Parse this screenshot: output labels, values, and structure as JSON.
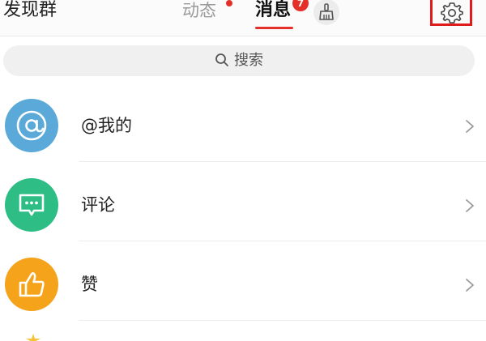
{
  "header": {
    "discover_label": "发现群",
    "tabs": [
      {
        "label": "动态",
        "has_dot": true
      },
      {
        "label": "消息",
        "badge": "7",
        "active": true
      }
    ],
    "broom_icon": "broom-icon",
    "settings_icon": "gear-icon"
  },
  "search": {
    "placeholder": "搜索",
    "icon": "search-icon"
  },
  "items": [
    {
      "label": "@我的",
      "icon": "at-icon",
      "color": "#5aa9d9"
    },
    {
      "label": "评论",
      "icon": "comment-icon",
      "color": "#2ebd85"
    },
    {
      "label": "赞",
      "icon": "thumbs-up-icon",
      "color": "#f5a31a"
    }
  ],
  "colors": {
    "accent": "#e5302a",
    "highlight_box": "#e01b1b"
  }
}
